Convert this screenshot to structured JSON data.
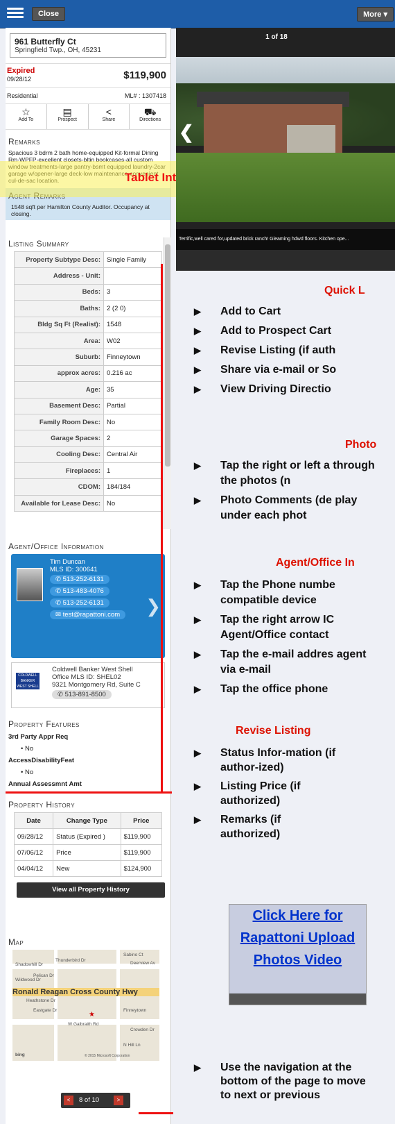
{
  "header": {
    "close_label": "Close",
    "more_label": "More ▾"
  },
  "listing": {
    "street": "961 Butterfly Ct",
    "city": "Springfield Twp., OH, 45231",
    "status": "Expired",
    "status_date": "09/28/12",
    "price": "$119,900",
    "type": "Residential",
    "mls": "ML# : 1307418"
  },
  "actions": {
    "add_to": "Add To",
    "prospect": "Prospect",
    "share": "Share",
    "directions": "Directions"
  },
  "remarks": {
    "title": "Remarks",
    "text": "Spacious 3 bdrm 2 bath home-equipped Kit-formal Dining Rm-WPFP-excellent closets-bltin bookcases-all custom window treatments-large pantry-bsmt equipped laundry-2car garage w/opener-large deck-low maintenance-convenient cul-de-sac location.",
    "agent_title": "Agent Remarks",
    "agent_text": "1548 sqft per Hamilton County Auditor. Occupancy at closing."
  },
  "tablet_label": "Tablet Interface",
  "photo": {
    "counter": "1 of 18",
    "caption": "Terrific,well cared for,updated brick ranch! Gleaming hdwd floors. Kitchen ope..."
  },
  "summary": {
    "title": "Listing Summary",
    "rows": [
      [
        "Property Subtype Desc:",
        "Single Family"
      ],
      [
        "Address - Unit:",
        ""
      ],
      [
        "Beds:",
        "3"
      ],
      [
        "Baths:",
        "2 (2 0)"
      ],
      [
        "Bldg Sq Ft (Realist):",
        "1548"
      ],
      [
        "Area:",
        "W02"
      ],
      [
        "Suburb:",
        "Finneytown"
      ],
      [
        "approx acres:",
        "0.216 ac"
      ],
      [
        "Age:",
        "35"
      ],
      [
        "Basement Desc:",
        "Partial"
      ],
      [
        "Family Room Desc:",
        "No"
      ],
      [
        "Garage Spaces:",
        "2"
      ],
      [
        "Cooling Desc:",
        "Central Air"
      ],
      [
        "Fireplaces:",
        "1"
      ],
      [
        "CDOM:",
        "184/184"
      ],
      [
        "Available for Lease Desc:",
        "No"
      ]
    ]
  },
  "agent": {
    "title": "Agent/Office Information",
    "name": "Tim Duncan",
    "mls_id": "MLS ID:  300641",
    "phone1": "513-252-6131",
    "phone2": "513-483-4076",
    "phone3": "513-252-6131",
    "email": "test@rapattoni.com",
    "office_name": "Coldwell Banker West Shell",
    "office_id": "Office MLS ID:  SHEL02",
    "office_addr": "9321 Montgomery Rd, Suite C",
    "office_phone": "513-891-8500",
    "office_logo": "COLDWELL BANKER WEST SHELL"
  },
  "features": {
    "title": "Property Features",
    "k1": "3rd Party Appr Req",
    "v1": "No",
    "k2": "AccessDisabilityFeat",
    "v2": "No",
    "k3": "Annual Assessmnt Amt"
  },
  "history": {
    "title": "Property History",
    "headers": [
      "Date",
      "Change Type",
      "Price"
    ],
    "rows": [
      [
        "09/28/12",
        "Status\n(Expired )",
        "$119,900"
      ],
      [
        "07/06/12",
        "Price",
        "$119,900"
      ],
      [
        "04/04/12",
        "New",
        "$124,900"
      ]
    ],
    "view_all": "View all Property History"
  },
  "map": {
    "title": "Map",
    "highway": "Ronald Reagan Cross County Hwy",
    "labels": [
      "Thunderbird Dr",
      "Pelican Dr",
      "Heathstone Dr",
      "Eastgate Dr",
      "W Galbraith Rd",
      "Sabino Ct",
      "Deerview Av",
      "Finneytown",
      "Crowden Dr",
      "N Hill Ln",
      "Shadowhill Dr",
      "Wildwood Dr"
    ],
    "copyright": "© 2015 Microsoft Corporation",
    "bing": "bing"
  },
  "pager": {
    "prev": "<",
    "text": "8 of 10",
    "next": ">"
  },
  "quick": {
    "title": "Quick L",
    "items": [
      "Add to Cart",
      "Add to Prospect Cart",
      "Revise Listing (if auth",
      "Share via e-mail or So",
      "View Driving Directio"
    ]
  },
  "photos_section": {
    "title": "Photo",
    "items": [
      "Tap the right or left a through the photos (n",
      "Photo Comments (de play under each phot"
    ]
  },
  "agent_section": {
    "title": "Agent/Office In",
    "items": [
      "Tap the Phone numbe compatible device",
      "Tap the right arrow IC Agent/Office contact",
      "Tap the e-mail addres agent via e-mail",
      "Tap the office phone"
    ]
  },
  "revise": {
    "title": "Revise Listing",
    "items": [
      "Status Infor-mation (if author-ized)",
      "Listing Price (if authorized)",
      "Remarks (if authorized)"
    ]
  },
  "video": {
    "text": "Click Here for Rapattoni Upload Photos Video"
  },
  "nav_note": "Use the navigation at the bottom of the page to move to next or previous"
}
